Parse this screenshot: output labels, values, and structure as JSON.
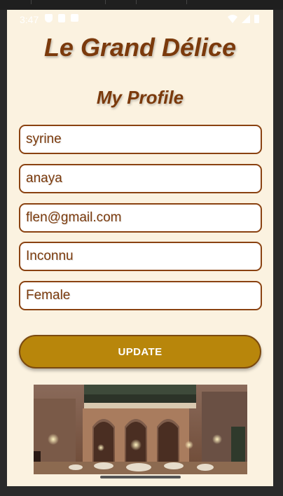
{
  "status_bar": {
    "time": "3:47"
  },
  "app": {
    "title": "Le Grand Délice"
  },
  "profile": {
    "title": "My Profile",
    "fields": {
      "first_name": "syrine",
      "last_name": "anaya",
      "email": "flen@gmail.com",
      "address": "Inconnu",
      "gender": "Female"
    },
    "update_label": "UPDATE"
  },
  "colors": {
    "background": "#fbf2e0",
    "brand_brown": "#7b3a0c",
    "button_gold": "#b8860b"
  }
}
